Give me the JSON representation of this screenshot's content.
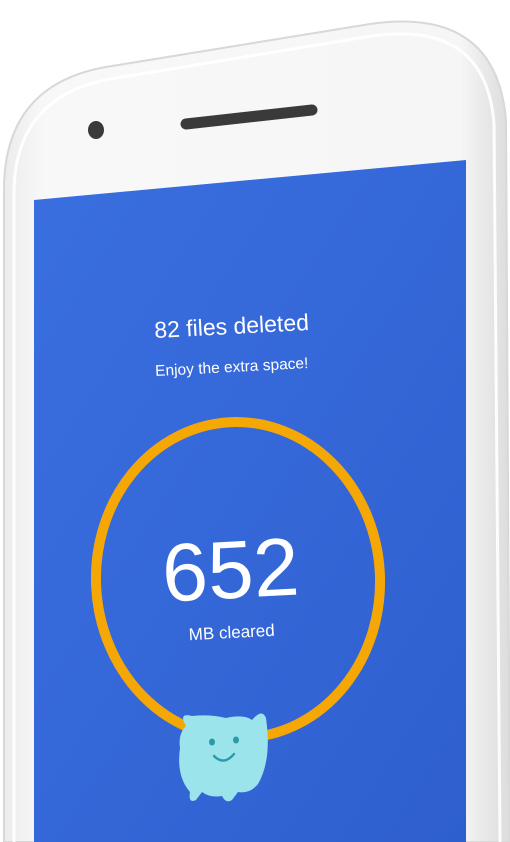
{
  "screen": {
    "headline": "82 files deleted",
    "subheadline": "Enjoy the extra space!",
    "amount": "652",
    "unit_label": "MB cleared"
  },
  "colors": {
    "screen_background": "#3366d6",
    "ring": "#f5a805",
    "mascot": "#9be4ec",
    "mascot_face": "#2a9aa8",
    "phone_body": "#f4f4f4",
    "text": "#ffffff"
  },
  "icons": {
    "front_camera": "camera-dot-icon",
    "speaker": "speaker-grille-icon",
    "mascot": "smiling-blob-mascot-icon"
  }
}
